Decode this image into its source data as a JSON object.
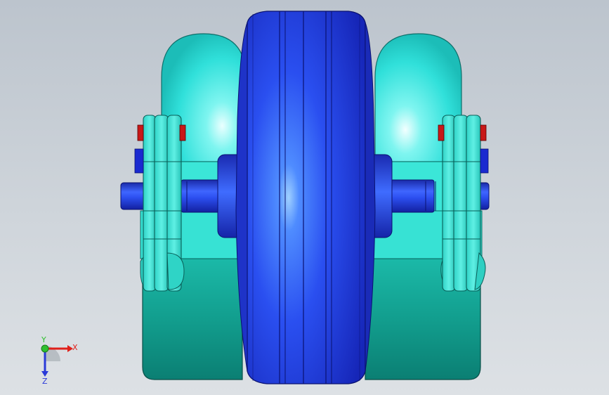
{
  "viewport": {
    "background_top": "#bcc4cd",
    "background_bottom": "#dde1e5"
  },
  "model": {
    "colors": {
      "wheel_blue": "#2438d8",
      "bumper_cyan": "#33e6e0",
      "base_teal": "#16a898",
      "bracket_cyan": "#40e6d8",
      "marker_red": "#c81818",
      "marker_blue": "#1a2ad0"
    }
  },
  "triad": {
    "x_label": "X",
    "y_label": "Y",
    "z_label": "Z",
    "x_color": "#e0201a",
    "y_color": "#2fbf2f",
    "z_color": "#2a3ad8"
  }
}
